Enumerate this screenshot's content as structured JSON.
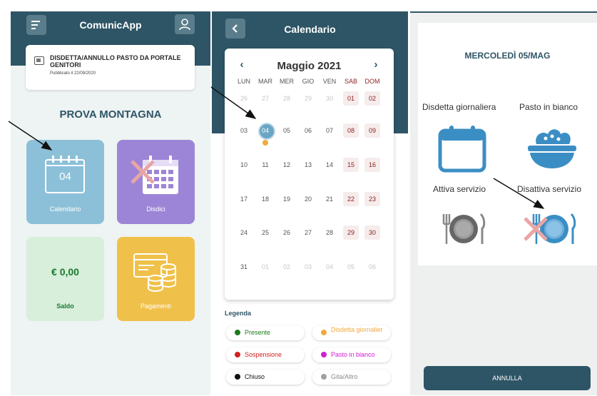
{
  "home": {
    "app_title": "ComunicApp",
    "notice": {
      "title": "DISDETTA/ANNULLO PASTO DA PORTALE GENITORI",
      "date": "Pubblicato il 22/09/2020"
    },
    "school": "PROVA MONTAGNA",
    "tiles": {
      "calendar_label": "Calendario",
      "calendar_day": "04",
      "disdici_label": "Disdici",
      "saldo_amount": "€ 0,00",
      "saldo_label": "Saldo",
      "pagamenti_label": "Pagamenti"
    }
  },
  "calendar": {
    "page_title": "Calendario",
    "month_label": "Maggio 2021",
    "prev_arrow": "‹",
    "next_arrow": "›",
    "weekdays": [
      "LUN",
      "MAR",
      "MER",
      "GIO",
      "VEN",
      "SAB",
      "DOM"
    ],
    "weeks": [
      [
        "26",
        "27",
        "28",
        "29",
        "30",
        "01",
        "02"
      ],
      [
        "03",
        "04",
        "05",
        "06",
        "07",
        "08",
        "09"
      ],
      [
        "10",
        "11",
        "12",
        "13",
        "14",
        "15",
        "16"
      ],
      [
        "17",
        "18",
        "19",
        "20",
        "21",
        "22",
        "23"
      ],
      [
        "24",
        "25",
        "26",
        "27",
        "28",
        "29",
        "30"
      ],
      [
        "31",
        "01",
        "02",
        "03",
        "04",
        "05",
        "06"
      ]
    ],
    "selected_day": "04",
    "legend_title": "Legenda",
    "legend": [
      {
        "label": "Presente",
        "color": "#1b7a1b",
        "text_color": "#1b7a1b"
      },
      {
        "label": "Disdetta giornalier",
        "color": "#f2a93b",
        "text_color": "#f2a93b"
      },
      {
        "label": "Sospensione",
        "color": "#d32020",
        "text_color": "#d32020"
      },
      {
        "label": "Pasto in bianco",
        "color": "#d020d0",
        "text_color": "#d020d0"
      },
      {
        "label": "Chiuso",
        "color": "#111111",
        "text_color": "#111111"
      },
      {
        "label": "Gita/Altro",
        "color": "#a0a0a0",
        "text_color": "#8a8a8a"
      }
    ]
  },
  "day_detail": {
    "title": "MERCOLEDÌ 05/MAG",
    "options": {
      "disdetta": "Disdetta giornaliera",
      "bianco": "Pasto in bianco",
      "attiva": "Attiva servizio",
      "disattiva": "Disattiva servizio"
    },
    "cancel_label": "ANNULLA"
  },
  "colors": {
    "primary": "#2e5566",
    "accent_blue": "#3b8ec4",
    "calendar_tile": "#8cc0d8",
    "disdici_tile": "#9c85d6",
    "saldo_tile": "#d7efdb",
    "pagamenti_tile": "#f0c14a",
    "weekend": "#8f2323"
  }
}
